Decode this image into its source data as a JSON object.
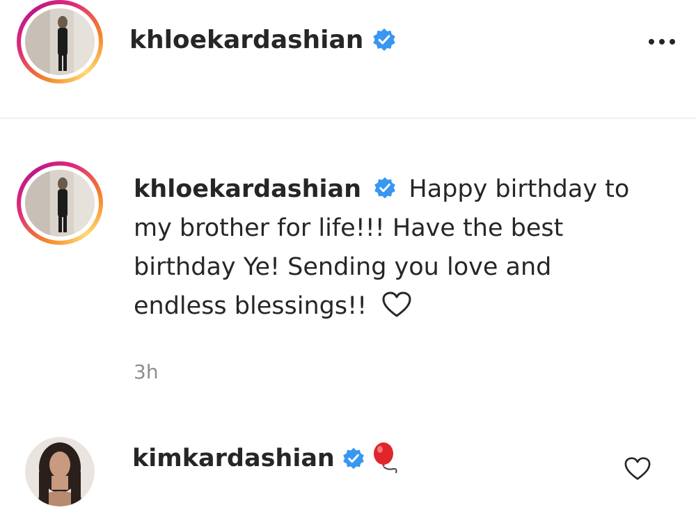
{
  "header": {
    "username": "khloekardashian",
    "more_icon": "ellipsis-icon"
  },
  "caption": {
    "username": "khloekardashian",
    "text_line1": "Happy birthday to",
    "text_line2": "my brother for life!!! Have the best",
    "text_line3": "birthday Ye! Sending you love and",
    "text_line4": "endless blessings!!",
    "emoji_icon": "white-heart-icon",
    "timestamp": "3h"
  },
  "comment": {
    "username": "kimkardashian",
    "emoji_icon": "balloon-icon",
    "like_icon": "heart-outline-icon"
  },
  "colors": {
    "verified_blue": "#3897f0",
    "text": "#262626",
    "muted": "#8e8e8e",
    "divider": "#efefef"
  }
}
